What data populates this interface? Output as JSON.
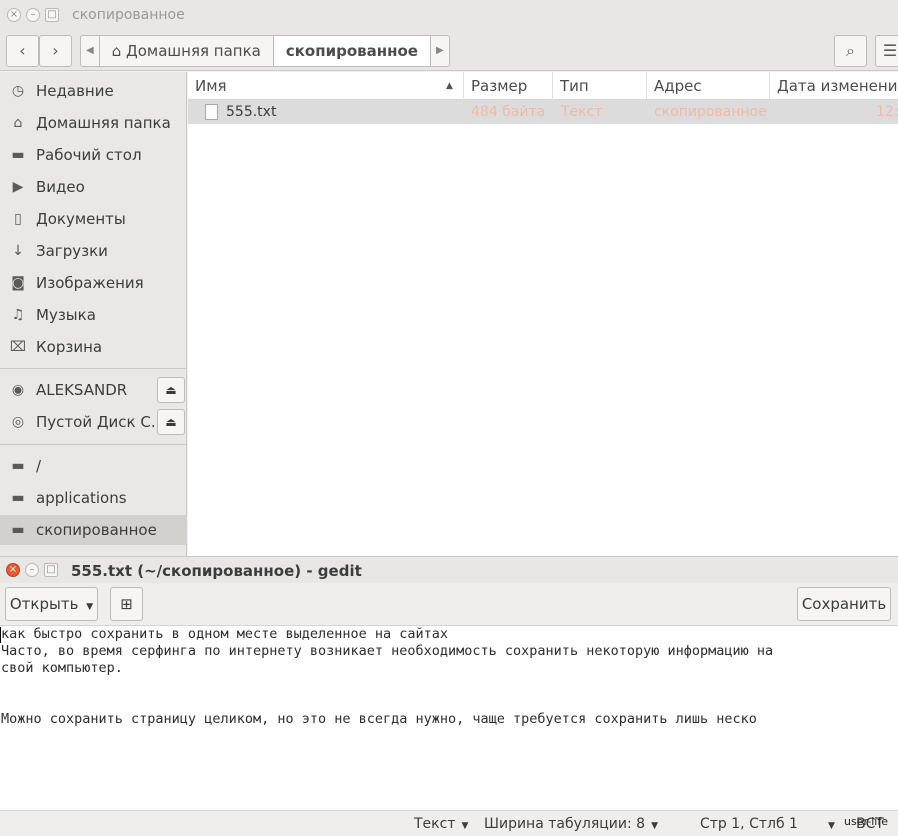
{
  "nautilus": {
    "title": "скопированное",
    "breadcrumbs": [
      "Домашняя папка",
      "скопированное"
    ],
    "sidebar": {
      "places": [
        {
          "label": "Недавние",
          "icon": "clock-icon"
        },
        {
          "label": "Домашняя папка",
          "icon": "home-icon"
        },
        {
          "label": "Рабочий стол",
          "icon": "folder-icon"
        },
        {
          "label": "Видео",
          "icon": "video-icon"
        },
        {
          "label": "Документы",
          "icon": "document-icon"
        },
        {
          "label": "Загрузки",
          "icon": "download-icon"
        },
        {
          "label": "Изображения",
          "icon": "camera-icon"
        },
        {
          "label": "Музыка",
          "icon": "music-icon"
        },
        {
          "label": "Корзина",
          "icon": "trash-icon"
        }
      ],
      "devices": [
        {
          "label": "ALEKSANDR",
          "icon": "drive-icon"
        },
        {
          "label": "Пустой Диск С...",
          "icon": "disc-icon"
        }
      ],
      "bookmarks": [
        {
          "label": "/",
          "icon": "folder-icon"
        },
        {
          "label": "applications",
          "icon": "folder-icon"
        },
        {
          "label": "скопированное",
          "icon": "folder-icon",
          "selected": true
        }
      ]
    },
    "columns": [
      "Имя",
      "Размер",
      "Тип",
      "Адрес",
      "Дата изменения"
    ],
    "files": [
      {
        "name": "555.txt",
        "size": "484 байта",
        "type": "Текст",
        "location": "скопированное",
        "modified": "12:"
      }
    ]
  },
  "gedit": {
    "title": "555.txt (~/скопированное) - gedit",
    "open_label": "Открыть",
    "save_label": "Сохранить",
    "lines": [
      "как быстро сохранить в одном месте выделенное на сайтах",
      "Часто, во время серфинга по интернету возникает необходимость сохранить некоторую информацию на",
      "свой компьютер.",
      "",
      "",
      "Можно сохранить страницу целиком, но это не всегда нужно, чаще требуется сохранить лишь неско"
    ],
    "status": {
      "language": "Текст",
      "tab_width": "Ширина табуляции: 8",
      "position": "Стр 1, Стлб 1",
      "mode": "ВСТ"
    },
    "watermark": "user-life"
  }
}
